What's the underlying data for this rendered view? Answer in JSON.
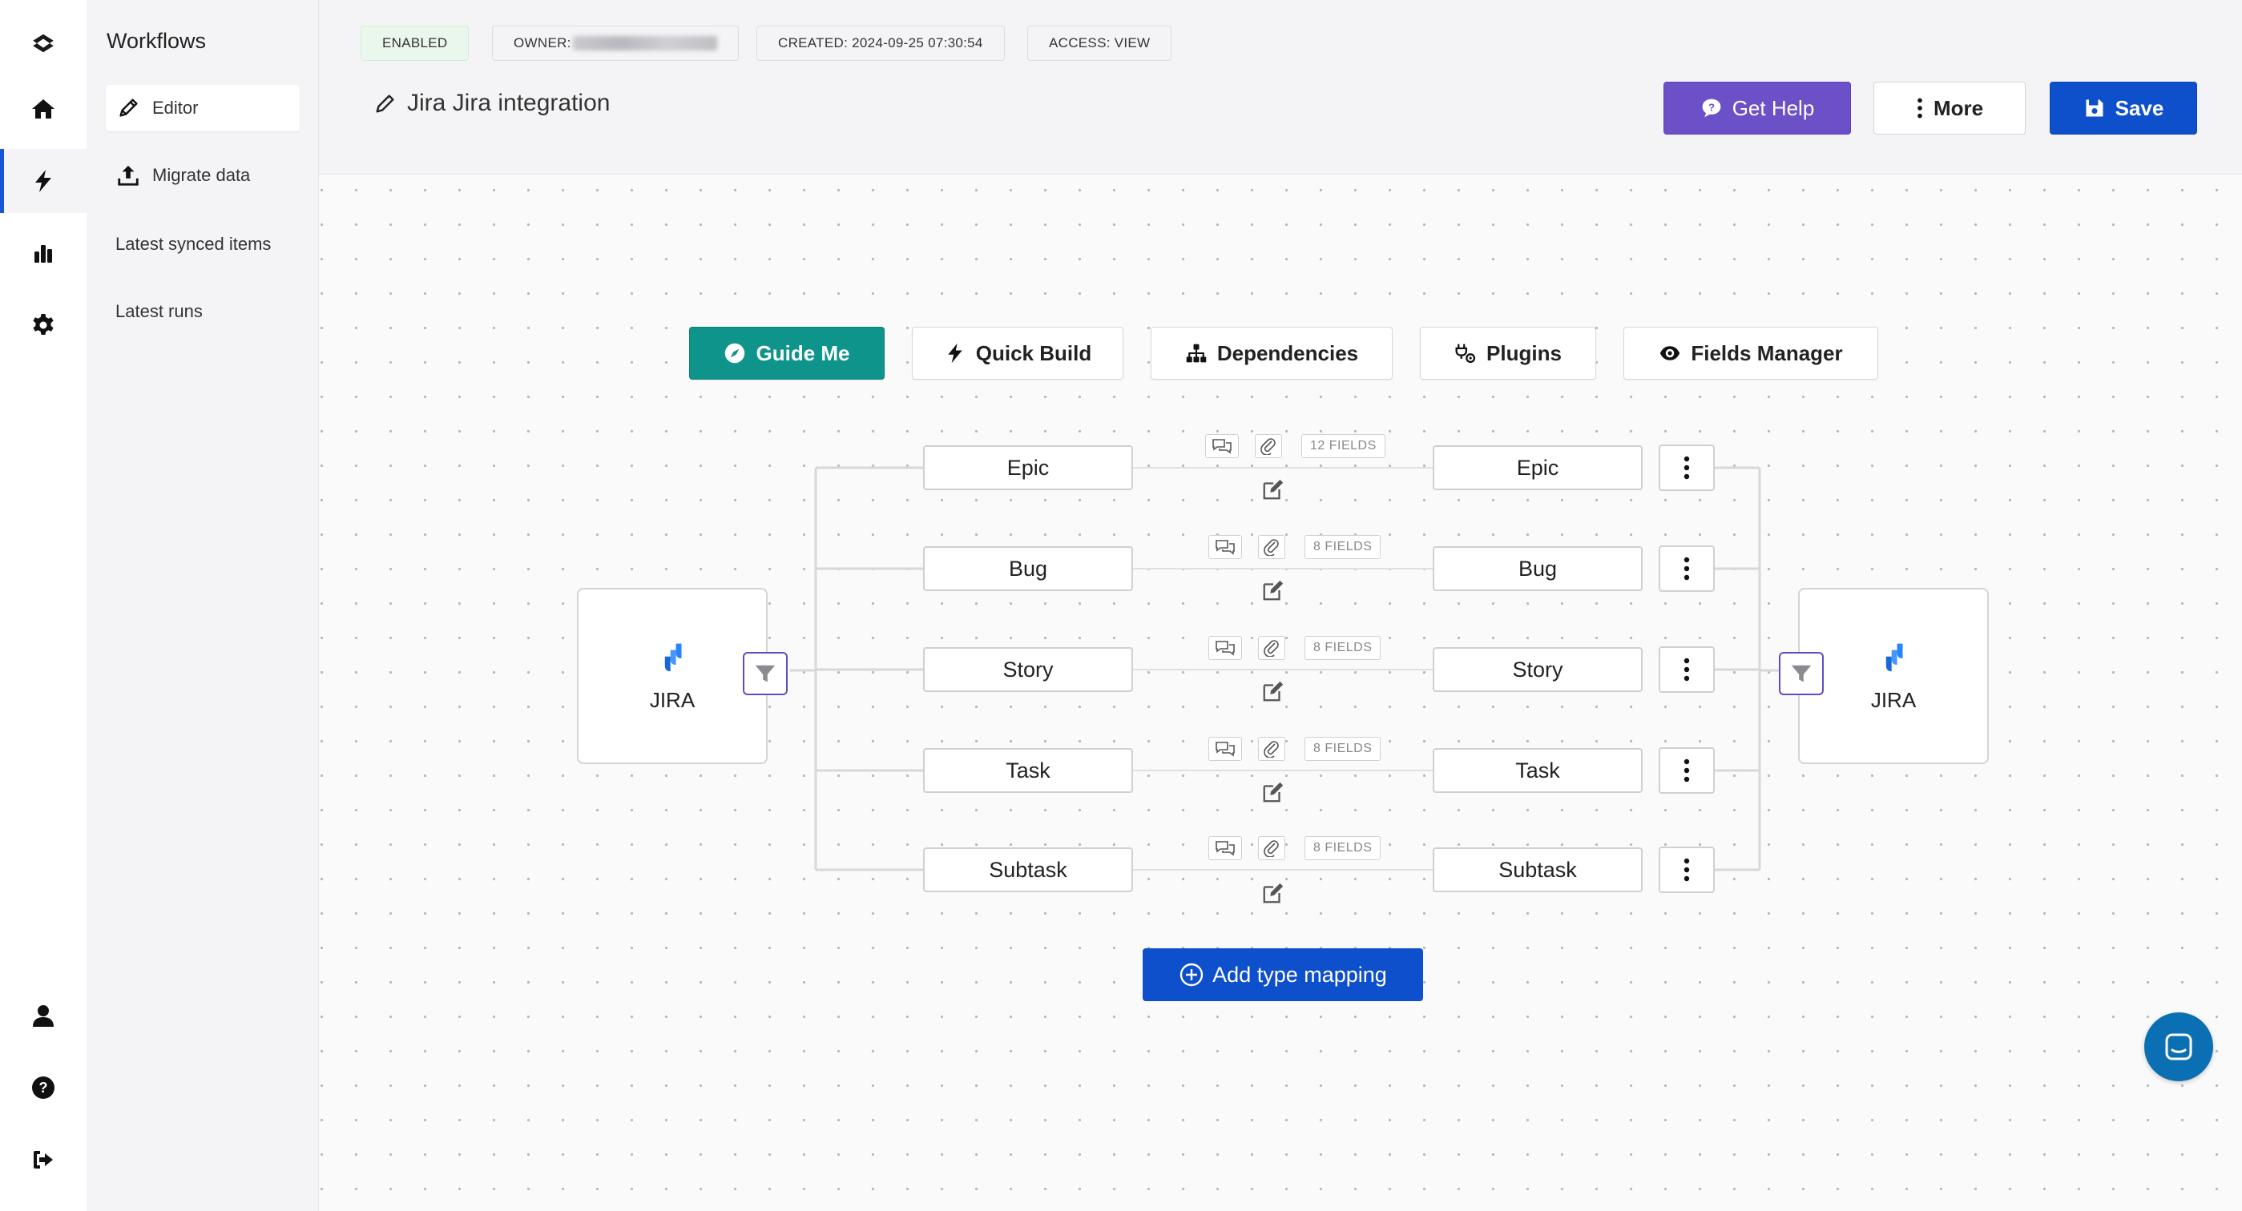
{
  "sidebar": {
    "title": "Workflows",
    "items": [
      {
        "label": "Editor",
        "icon": "pencil-icon"
      },
      {
        "label": "Migrate data",
        "icon": "upload-icon"
      },
      {
        "label": "Latest synced items"
      },
      {
        "label": "Latest runs"
      }
    ]
  },
  "rail": {
    "icons": [
      "logo-icon",
      "home-icon",
      "bolt-icon",
      "chart-icon",
      "gear-icon",
      "user-icon",
      "help-icon",
      "logout-icon"
    ]
  },
  "header": {
    "status": "ENABLED",
    "owner_label": "OWNER:",
    "created": "CREATED: 2024-09-25 07:30:54",
    "access": "ACCESS: VIEW",
    "title": "Jira Jira integration",
    "buttons": {
      "help": "Get Help",
      "more": "More",
      "save": "Save"
    }
  },
  "toolbar": {
    "guide": "Guide Me",
    "quick_build": "Quick Build",
    "dependencies": "Dependencies",
    "plugins": "Plugins",
    "fields_manager": "Fields Manager"
  },
  "systems": {
    "left": "JIRA",
    "right": "JIRA"
  },
  "mappings": [
    {
      "source": "Epic",
      "target": "Epic",
      "fields": "12 FIELDS"
    },
    {
      "source": "Bug",
      "target": "Bug",
      "fields": "8 FIELDS"
    },
    {
      "source": "Story",
      "target": "Story",
      "fields": "8 FIELDS"
    },
    {
      "source": "Task",
      "target": "Task",
      "fields": "8 FIELDS"
    },
    {
      "source": "Subtask",
      "target": "Subtask",
      "fields": "8 FIELDS"
    }
  ],
  "add_mapping": "Add type mapping",
  "colors": {
    "primary": "#0e4fcb",
    "help": "#6b50c7",
    "guide": "#0e948b",
    "enabled_bg": "#eaf7ec",
    "filter_border": "#5b4fc4",
    "jira_blue": "#2684ff"
  }
}
